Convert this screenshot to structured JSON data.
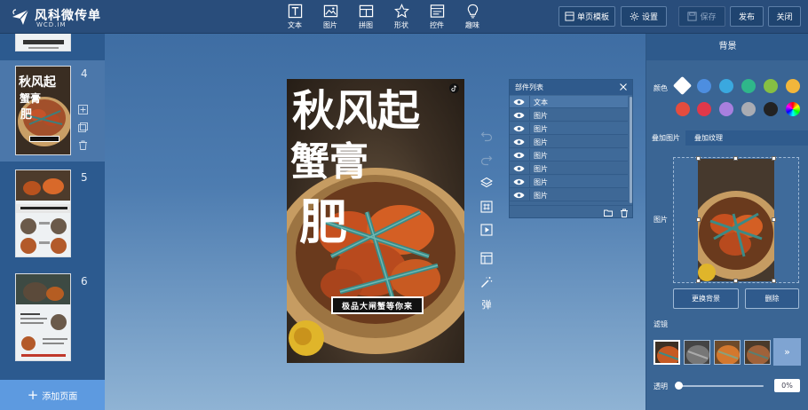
{
  "app": {
    "name": "风科微传单",
    "domain": "WCD.IM"
  },
  "toolbar": {
    "tools": [
      {
        "label": "文本",
        "icon": "text-icon"
      },
      {
        "label": "图片",
        "icon": "image-icon"
      },
      {
        "label": "拼图",
        "icon": "puzzle-icon"
      },
      {
        "label": "形状",
        "icon": "star-icon"
      },
      {
        "label": "控件",
        "icon": "widget-icon"
      },
      {
        "label": "趣味",
        "icon": "lightbulb-icon"
      }
    ],
    "template_label": "单页模板",
    "settings_label": "设置",
    "save_label": "保存",
    "publish_label": "发布",
    "close_label": "关闭"
  },
  "pages": {
    "items": [
      {
        "number": "4"
      },
      {
        "number": "5"
      },
      {
        "number": "6"
      }
    ],
    "active": "4",
    "add_label": "添加页面",
    "thumb4_caption": "极品大闸蟹等你来"
  },
  "poster": {
    "title_line1": "秋风起",
    "title_line2": "蟹膏",
    "title_line3": "肥",
    "caption": "极品大闸蟹等你来"
  },
  "canvas_tools": [
    "undo-icon",
    "redo-icon",
    "layers-icon",
    "grid-icon",
    "play-icon",
    "table-icon",
    "magic-wand-icon"
  ],
  "canvas_tools_popup": "弹",
  "layers": {
    "title": "部件列表",
    "items": [
      "文本",
      "图片",
      "图片",
      "图片",
      "图片",
      "图片",
      "图片",
      "图片"
    ]
  },
  "props": {
    "title": "背景",
    "color_label": "颜色",
    "colors": [
      "#ffffff",
      "#4d8ee0",
      "#3aa8df",
      "#2fb68a",
      "#86bf43",
      "#f2b63b",
      "#e44c3e",
      "#e0384a",
      "#a87fde",
      "#a9acb3",
      "#222222",
      "rainbow"
    ],
    "tabs": [
      "叠加图片",
      "叠加纹理"
    ],
    "image_label": "图片",
    "replace_label": "更换背景",
    "delete_label": "删除",
    "filter_label": "滤镜",
    "filter_more": "»",
    "opacity_label": "透明",
    "opacity_value": "0%",
    "opacity": 0
  }
}
